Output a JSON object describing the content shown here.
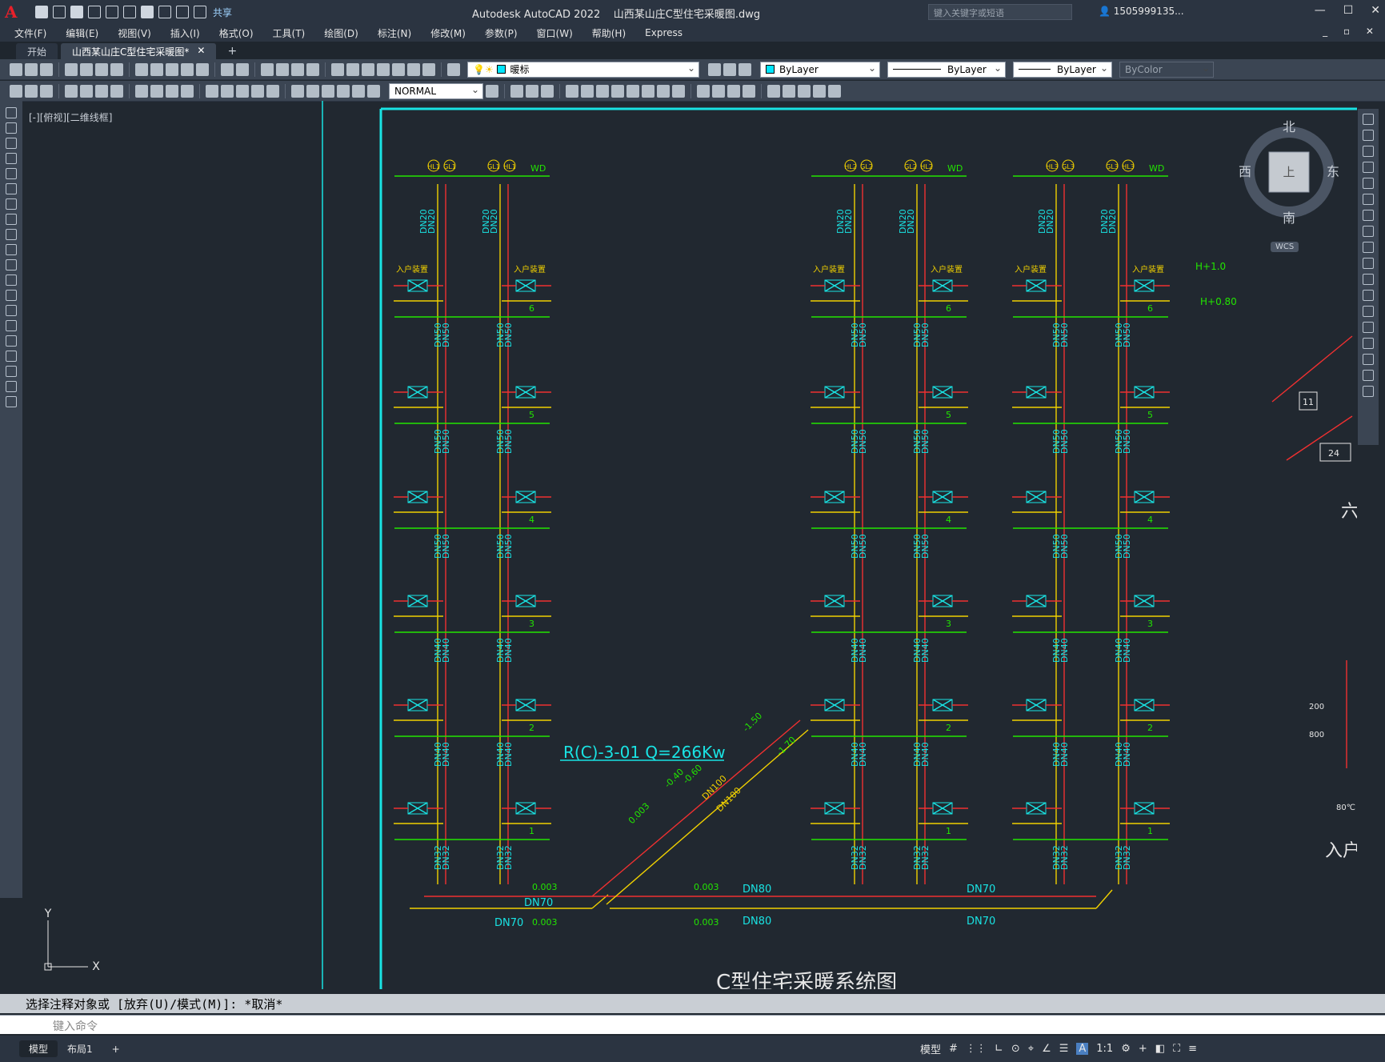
{
  "app": {
    "title": "Autodesk AutoCAD 2022    山西某山庄C型住宅采暖图.dwg",
    "share": "共享",
    "search_placeholder": "键入关键字或短语",
    "user": "1505999135...",
    "logo": "A"
  },
  "menu": [
    "文件(F)",
    "编辑(E)",
    "视图(V)",
    "插入(I)",
    "格式(O)",
    "工具(T)",
    "绘图(D)",
    "标注(N)",
    "修改(M)",
    "参数(P)",
    "窗口(W)",
    "帮助(H)",
    "Express"
  ],
  "tabs": {
    "start": "开始",
    "active": "山西某山庄C型住宅采暖图*",
    "close": "✕",
    "new": "+"
  },
  "toolbar": {
    "layer": "暖标",
    "color": "ByLayer",
    "linetype": "ByLayer",
    "lineweight": "ByLayer",
    "plotstyle": "ByColor",
    "dimstyle": "NORMAL"
  },
  "viewport": {
    "label": "[-][俯视][二维线框]"
  },
  "compass": {
    "north": "北",
    "south": "南",
    "east": "东",
    "west": "西",
    "top": "上",
    "wcs": "WCS"
  },
  "drawing": {
    "title": "C型住宅采暖系统图",
    "main_label": "R(C)-3-01  Q=266Kw",
    "wd": "WD",
    "entry": "入户装置",
    "floors": [
      "1",
      "2",
      "3",
      "4",
      "5",
      "6"
    ],
    "risers_a": [
      "HL1",
      "GL1",
      "GL1",
      "HL1"
    ],
    "risers_b": [
      "HL2",
      "GL2",
      "GL2",
      "HL2"
    ],
    "risers_c": [
      "HL3",
      "GL3",
      "GL3",
      "HL3"
    ],
    "pipe_sizes_top": "DN20",
    "pipe_sizes": [
      "DN32",
      "DN40",
      "DN40",
      "DN50",
      "DN50",
      "DN50"
    ],
    "slopes": [
      "0.003",
      "0.003",
      "0.003",
      "0.003",
      "0.003"
    ],
    "mains": [
      "DN70",
      "DN70",
      "DN80",
      "DN80",
      "DN70",
      "DN70",
      "DN100",
      "DN100"
    ],
    "levels": [
      "-1.50",
      "-1.70",
      "-0.40",
      "-0.60",
      "H+1.0",
      "H+0.80"
    ],
    "right_labels": [
      "11",
      "24",
      "200",
      "800",
      "80℃",
      "入户",
      "六"
    ]
  },
  "command": {
    "history": "选择注释对象或 [放弃(U)/模式(M)]: *取消*",
    "placeholder": "键入命令"
  },
  "layouts": {
    "model": "模型",
    "layout1": "布局1",
    "add": "+"
  },
  "status": {
    "model": "模型",
    "scale": "1:1"
  }
}
